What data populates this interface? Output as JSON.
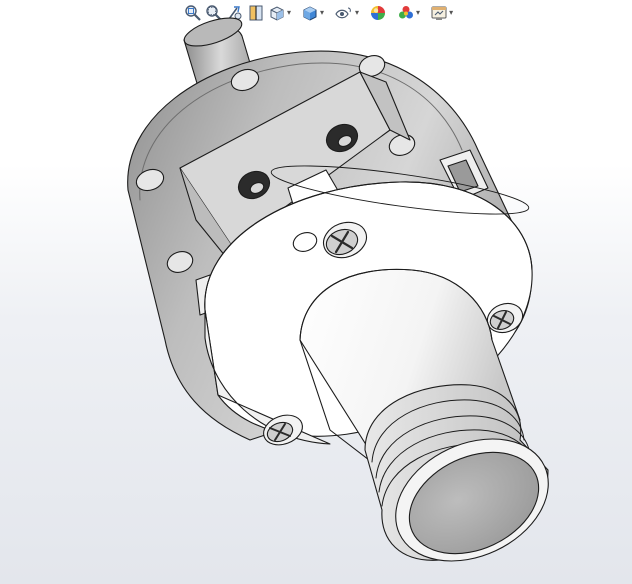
{
  "viewport": {
    "background_top": "#ffffff",
    "background_bottom": "#e3e6ec"
  },
  "toolbar": {
    "items": [
      {
        "id": "zoom-to-fit",
        "icon": "zoom-to-fit-icon",
        "has_menu": false
      },
      {
        "id": "zoom-to-area",
        "icon": "zoom-to-area-icon",
        "has_menu": false
      },
      {
        "id": "previous-view",
        "icon": "previous-view-icon",
        "has_menu": false
      },
      {
        "id": "section-view",
        "icon": "section-view-icon",
        "has_menu": false
      },
      {
        "id": "view-orientation",
        "icon": "view-orientation-icon",
        "has_menu": true
      },
      {
        "id": "display-style",
        "icon": "display-style-icon",
        "has_menu": true
      },
      {
        "id": "hide-show-items",
        "icon": "hide-show-items-icon",
        "has_menu": true
      },
      {
        "id": "edit-appearance",
        "icon": "edit-appearance-icon",
        "has_menu": false
      },
      {
        "id": "apply-scene",
        "icon": "apply-scene-icon",
        "has_menu": true
      },
      {
        "id": "view-settings",
        "icon": "view-settings-icon",
        "has_menu": true
      }
    ],
    "caret_glyph": "▾"
  },
  "model": {
    "part": "rotary-actuator-3d-model",
    "colors": {
      "body": "#c9c9c9",
      "body_dark": "#9a9a9a",
      "face_light": "#f4f4f4",
      "face_white": "#ffffff",
      "edge": "#1c1c1c",
      "hole": "#2b2b2b"
    }
  }
}
